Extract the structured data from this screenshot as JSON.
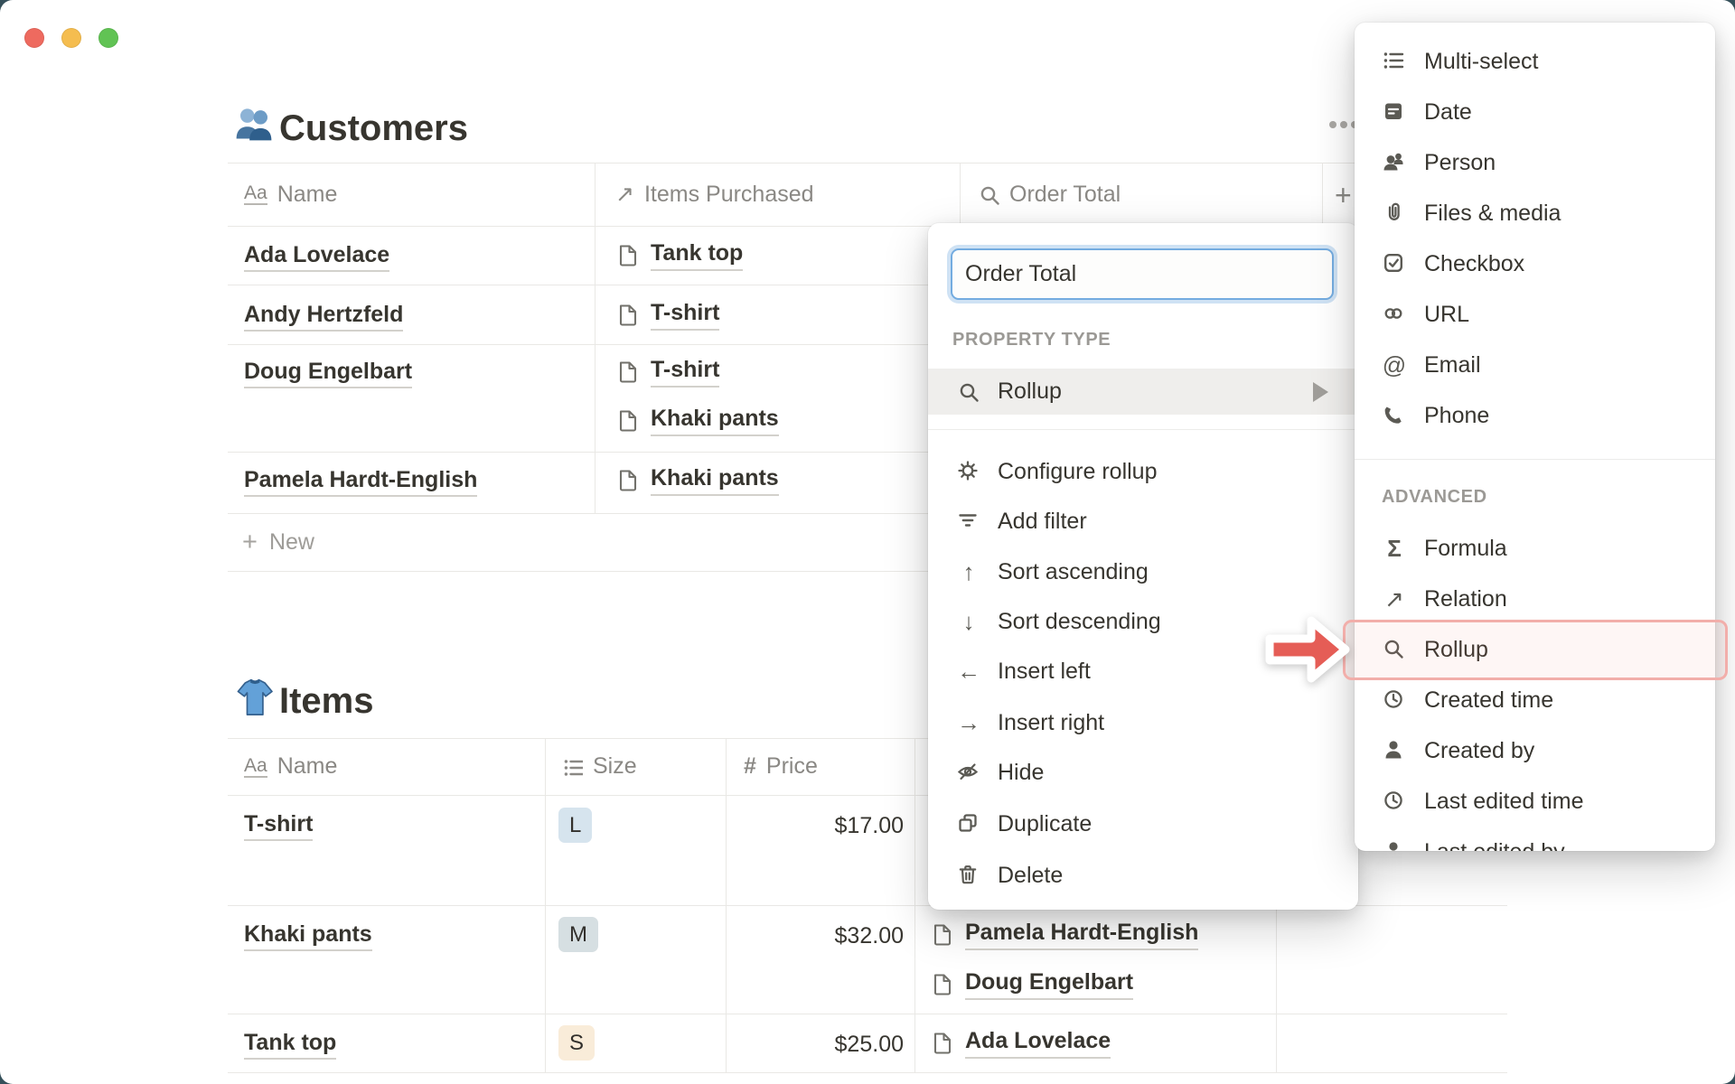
{
  "window": {
    "traffic_lights": [
      "close",
      "minimize",
      "zoom"
    ]
  },
  "icons": {
    "text": "Aa",
    "relation": "↗",
    "hash": "#",
    "at": "@",
    "formula": "Σ",
    "plus": "+",
    "arrow_up": "↑",
    "arrow_down": "↓",
    "arrow_left": "←",
    "arrow_right": "→"
  },
  "customers": {
    "title": "Customers",
    "title_icon": "people-emoji",
    "columns": [
      {
        "icon": "text-icon",
        "label": "Name"
      },
      {
        "icon": "relation-icon",
        "label": "Items Purchased"
      },
      {
        "icon": "rollup-icon",
        "label": "Order Total"
      }
    ],
    "rows": [
      {
        "name": "Ada Lovelace",
        "items": [
          "Tank top"
        ]
      },
      {
        "name": "Andy Hertzfeld",
        "items": [
          "T-shirt"
        ]
      },
      {
        "name": "Doug Engelbart",
        "items": [
          "T-shirt",
          "Khaki pants"
        ]
      },
      {
        "name": "Pamela Hardt-English",
        "items": [
          "Khaki pants"
        ]
      }
    ],
    "new_row_label": "New"
  },
  "items": {
    "title": "Items",
    "title_icon": "tshirt-emoji",
    "columns": [
      {
        "icon": "text-icon",
        "label": "Name"
      },
      {
        "icon": "list-icon",
        "label": "Size"
      },
      {
        "icon": "hash-icon",
        "label": "Price"
      }
    ],
    "rows": [
      {
        "name": "T-shirt",
        "size": "L",
        "size_color": "#d6e4ee",
        "price": "$17.00",
        "purchased_by": []
      },
      {
        "name": "Khaki pants",
        "size": "M",
        "size_color": "#d6dfe2",
        "price": "$32.00",
        "purchased_by": [
          "Pamela Hardt-English",
          "Doug Engelbart"
        ]
      },
      {
        "name": "Tank top",
        "size": "S",
        "size_color": "#f9ecd9",
        "price": "$25.00",
        "purchased_by": [
          "Ada Lovelace"
        ]
      }
    ]
  },
  "property_menu": {
    "name_value": "Order Total",
    "section_label": "PROPERTY TYPE",
    "selected_type": {
      "icon": "rollup-icon",
      "label": "Rollup"
    },
    "actions": [
      {
        "icon": "gear-icon",
        "label": "Configure rollup"
      },
      {
        "icon": "filter-icon",
        "label": "Add filter"
      },
      {
        "icon": "arrow-up-icon",
        "label": "Sort ascending"
      },
      {
        "icon": "arrow-down-icon",
        "label": "Sort descending"
      },
      {
        "icon": "arrow-left-icon",
        "label": "Insert left"
      },
      {
        "icon": "arrow-right-icon",
        "label": "Insert right"
      },
      {
        "icon": "eye-off-icon",
        "label": "Hide"
      },
      {
        "icon": "duplicate-icon",
        "label": "Duplicate"
      },
      {
        "icon": "trash-icon",
        "label": "Delete"
      }
    ]
  },
  "type_menu": {
    "basic_items": [
      {
        "icon": "list-icon",
        "label": "Multi-select"
      },
      {
        "icon": "calendar-icon",
        "label": "Date"
      },
      {
        "icon": "person-icon",
        "label": "Person"
      },
      {
        "icon": "paperclip-icon",
        "label": "Files & media"
      },
      {
        "icon": "checkbox-icon",
        "label": "Checkbox"
      },
      {
        "icon": "url-icon",
        "label": "URL"
      },
      {
        "icon": "at-icon",
        "label": "Email"
      },
      {
        "icon": "phone-icon",
        "label": "Phone"
      }
    ],
    "advanced_label": "ADVANCED",
    "advanced_items": [
      {
        "icon": "formula-icon",
        "label": "Formula"
      },
      {
        "icon": "relation-icon",
        "label": "Relation"
      },
      {
        "icon": "rollup-icon",
        "label": "Rollup",
        "highlighted": true
      },
      {
        "icon": "clock-icon",
        "label": "Created time"
      },
      {
        "icon": "person-filled-icon",
        "label": "Created by"
      },
      {
        "icon": "clock-icon",
        "label": "Last edited time"
      },
      {
        "icon": "person-filled-icon",
        "label": "Last edited by"
      }
    ]
  },
  "colors": {
    "text": "#37352f",
    "secondary_text": "#8a8884",
    "grid_line": "#e9e8e5",
    "selected_row": "#efeeec",
    "focus_ring_blue": "#74ace0",
    "highlight_pink_border": "#f2aeaa",
    "annotation_arrow_red": "#e55d56",
    "traffic_red": "#ee6a5f",
    "traffic_yellow": "#f5bd4f",
    "traffic_green": "#61c354"
  }
}
